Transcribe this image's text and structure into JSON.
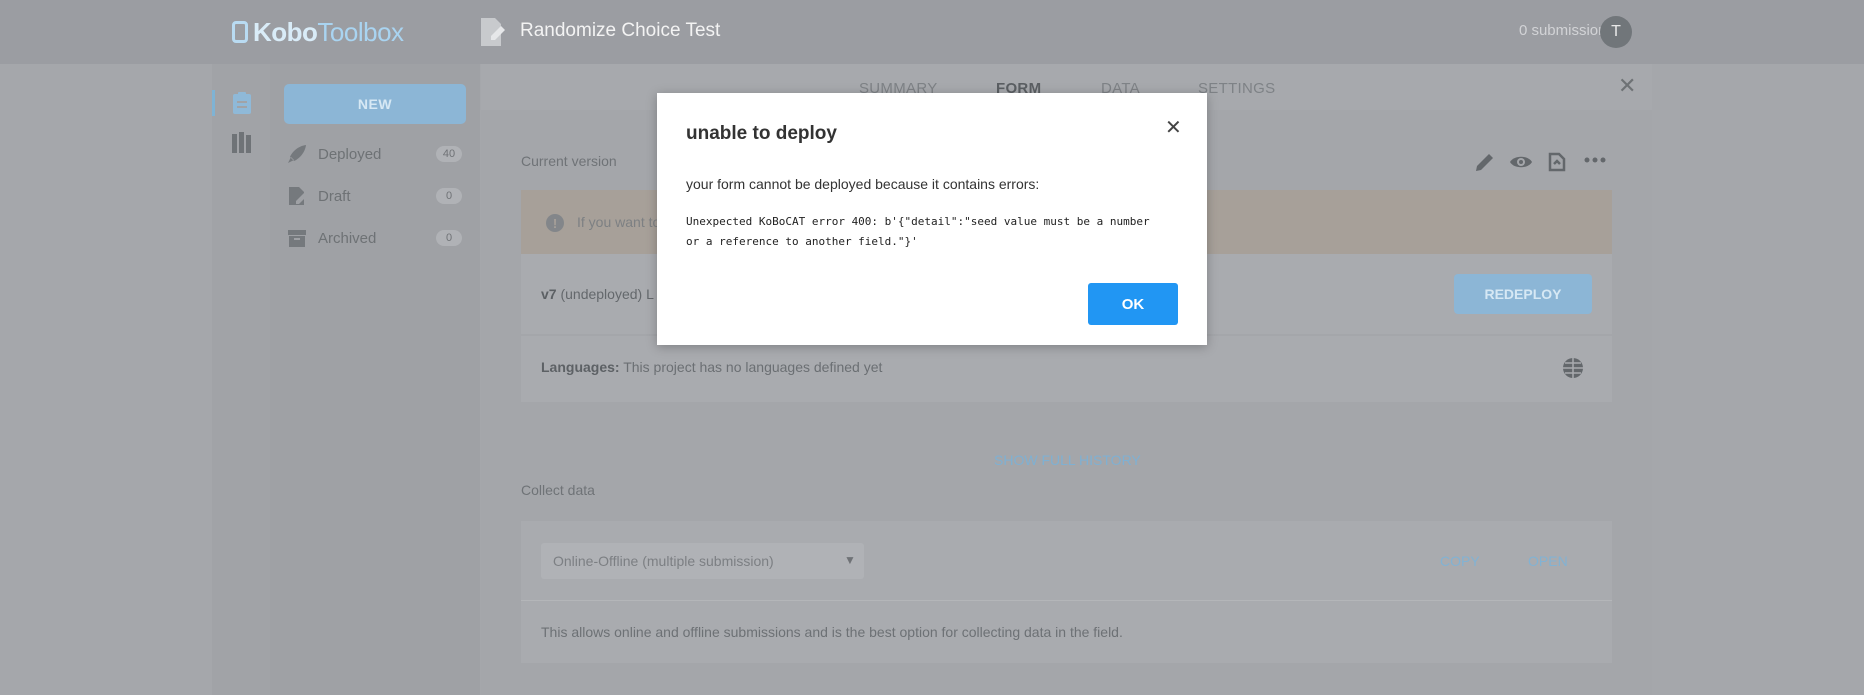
{
  "header": {
    "logo": {
      "part1": "Kobo",
      "part2": "Toolbox"
    },
    "project_title": "Randomize Choice Test",
    "submissions": "0 submissions",
    "avatar_initial": "T"
  },
  "sidebar": {
    "new_label": "NEW",
    "items": [
      {
        "label": "Deployed",
        "count": "40",
        "icon": "rocket-icon"
      },
      {
        "label": "Draft",
        "count": "0",
        "icon": "draft-icon"
      },
      {
        "label": "Archived",
        "count": "0",
        "icon": "archive-icon"
      }
    ]
  },
  "tabs": [
    "SUMMARY",
    "FORM",
    "DATA",
    "SETTINGS"
  ],
  "form": {
    "current_version_label": "Current version",
    "alert_text": "If you want to",
    "version": "v7",
    "version_status": "(undeployed)",
    "version_suffix": "L",
    "redeploy_label": "REDEPLOY",
    "languages_label": "Languages:",
    "languages_value": "This project has no languages defined yet",
    "history_link": "SHOW FULL HISTORY",
    "collect_label": "Collect data",
    "collect_select": "Online-Offline (multiple submission)",
    "copy_label": "COPY",
    "open_label": "OPEN",
    "collect_description": "This allows online and offline submissions and is the best option for collecting data in the field."
  },
  "modal": {
    "title": "unable to deploy",
    "message": "your form cannot be deployed because it contains errors:",
    "error_line1": "Unexpected KoBoCAT error 400: b'{\"detail\":\"seed value must be a number",
    "error_line2": "or a reference to another field.\"}'",
    "ok_label": "OK"
  },
  "colors": {
    "accent": "#2196f3",
    "overlay_brand": "#8cb6d6"
  }
}
